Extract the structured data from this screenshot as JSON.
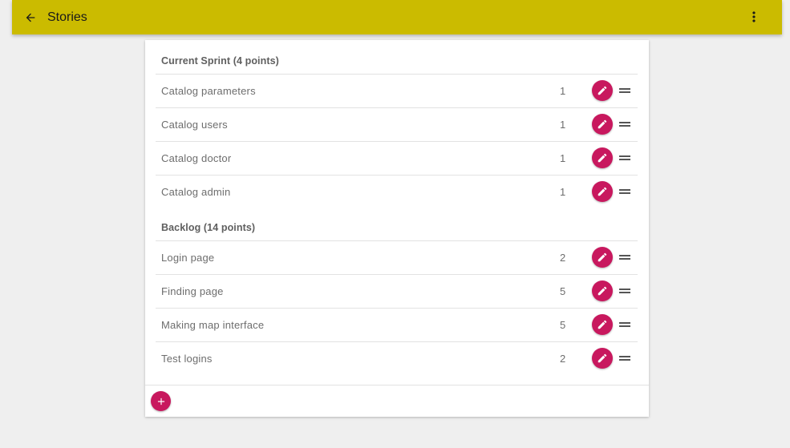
{
  "toolbar": {
    "title": "Stories",
    "back_icon": "arrow-back-icon",
    "menu_icon": "more-vert-icon",
    "background": "#cbbb00"
  },
  "accent_color": "#c8185e",
  "current_sprint": {
    "header": "Current Sprint (4 points)",
    "stories": [
      {
        "name": "Catalog parameters",
        "points": "1"
      },
      {
        "name": "Catalog users",
        "points": "1"
      },
      {
        "name": "Catalog doctor",
        "points": "1"
      },
      {
        "name": "Catalog admin",
        "points": "1"
      }
    ]
  },
  "backlog": {
    "header": "Backlog (14 points)",
    "stories": [
      {
        "name": "Login page",
        "points": "2"
      },
      {
        "name": "Finding page",
        "points": "5"
      },
      {
        "name": "Making map interface",
        "points": "5"
      },
      {
        "name": "Test logins",
        "points": "2"
      }
    ]
  },
  "row_icons": {
    "edit": "pencil-icon",
    "drag": "drag-handle-icon"
  },
  "add_button_icon": "plus-icon"
}
